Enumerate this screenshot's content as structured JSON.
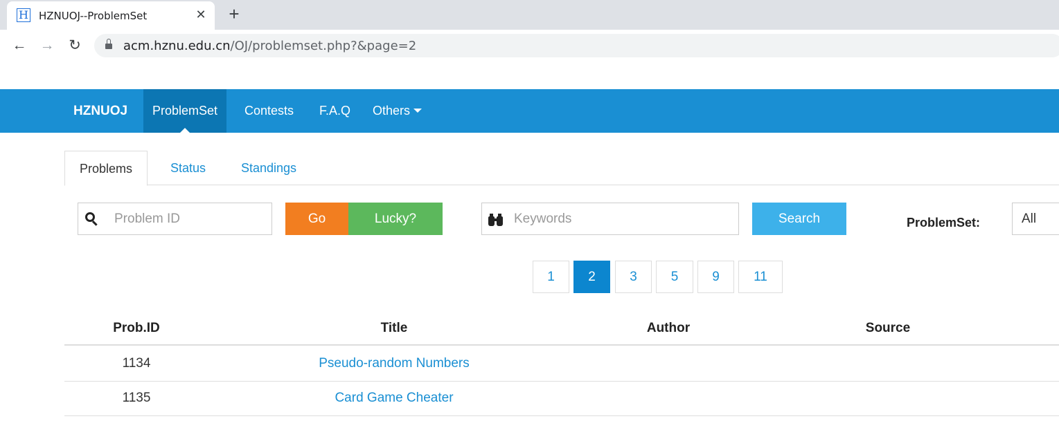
{
  "browser": {
    "tab_title": "HZNUOJ--ProblemSet",
    "favicon_letter": "H",
    "url_host": "acm.hznu.edu.cn",
    "url_path": "/OJ/problemset.php?&page=2",
    "icons": [
      "back-icon",
      "forward-icon",
      "reload-icon",
      "lock-icon",
      "close-icon",
      "plus-icon"
    ]
  },
  "navbar": {
    "brand": "HZNUOJ",
    "items": [
      {
        "label": "ProblemSet",
        "active": true
      },
      {
        "label": "Contests"
      },
      {
        "label": "F.A.Q"
      },
      {
        "label": "Others"
      }
    ],
    "color": "#1a8fd3",
    "active_color": "#0c76b3"
  },
  "tabs": [
    "Problems",
    "Status",
    "Standings"
  ],
  "search": {
    "id_placeholder": "Problem ID",
    "go_label": "Go",
    "lucky_label": "Lucky?",
    "keywords_placeholder": "Keywords",
    "search_label": "Search",
    "problemset_label": "ProblemSet:",
    "problemset_value": "All",
    "colors": {
      "go": "#f27e20",
      "lucky": "#5cb85c",
      "search": "#3db1ea"
    }
  },
  "pagination": {
    "pages": [
      "1",
      "2",
      "3",
      "5",
      "9",
      "11"
    ],
    "current": "2"
  },
  "table": {
    "headers": [
      "Prob.ID",
      "Title",
      "Author",
      "Source"
    ],
    "rows": [
      {
        "id": "1134",
        "title": "Pseudo-random Numbers",
        "author": "",
        "source": ""
      },
      {
        "id": "1135",
        "title": "Card Game Cheater",
        "author": "",
        "source": ""
      }
    ]
  }
}
